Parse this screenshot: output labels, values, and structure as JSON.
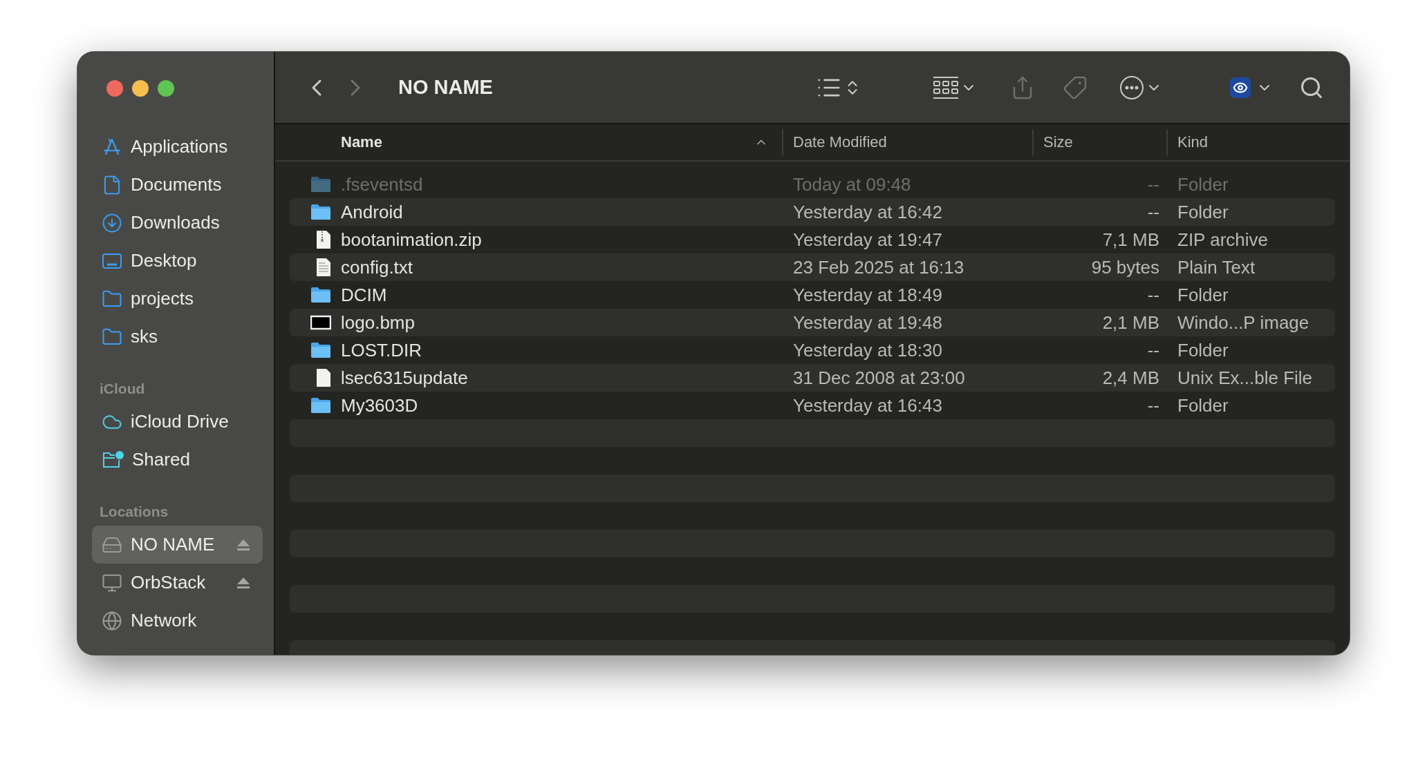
{
  "window": {
    "title": "NO NAME"
  },
  "toolbar": {
    "back_disabled": false,
    "forward_disabled": true,
    "share_disabled": true,
    "tags_disabled": true
  },
  "sidebar": {
    "sections": [
      {
        "items": [
          {
            "label": "Applications",
            "kind": "applications",
            "selected": false,
            "ejectable": false
          },
          {
            "label": "Documents",
            "kind": "documents",
            "selected": false,
            "ejectable": false
          },
          {
            "label": "Downloads",
            "kind": "downloads",
            "selected": false,
            "ejectable": false
          },
          {
            "label": "Desktop",
            "kind": "desktop",
            "selected": false,
            "ejectable": false
          },
          {
            "label": "projects",
            "kind": "folder",
            "selected": false,
            "ejectable": false
          },
          {
            "label": "sks",
            "kind": "folder",
            "selected": false,
            "ejectable": false
          }
        ]
      },
      {
        "title": "iCloud",
        "items": [
          {
            "label": "iCloud Drive",
            "kind": "cloud",
            "selected": false,
            "ejectable": false
          },
          {
            "label": "Shared",
            "kind": "shared",
            "selected": false,
            "ejectable": false
          }
        ]
      },
      {
        "title": "Locations",
        "items": [
          {
            "label": "NO NAME",
            "kind": "drive",
            "selected": true,
            "ejectable": true
          },
          {
            "label": "OrbStack",
            "kind": "computer",
            "selected": false,
            "ejectable": true
          },
          {
            "label": "Network",
            "kind": "network",
            "selected": false,
            "ejectable": false
          }
        ]
      }
    ]
  },
  "table": {
    "columns": [
      {
        "label": "Name",
        "sorted": true
      },
      {
        "label": "Date Modified",
        "sorted": false
      },
      {
        "label": "Size",
        "sorted": false
      },
      {
        "label": "Kind",
        "sorted": false
      }
    ],
    "rows": [
      {
        "name": ".fseventsd",
        "kind": "folder",
        "dimmed": true,
        "date_modified": "Today at 09:48",
        "size": "--",
        "file_kind": "Folder"
      },
      {
        "name": "Android",
        "kind": "folder",
        "dimmed": false,
        "date_modified": "Yesterday at 16:42",
        "size": "--",
        "file_kind": "Folder"
      },
      {
        "name": "bootanimation.zip",
        "kind": "archive",
        "dimmed": false,
        "date_modified": "Yesterday at 19:47",
        "size": "7,1 MB",
        "file_kind": "ZIP archive"
      },
      {
        "name": "config.txt",
        "kind": "text",
        "dimmed": false,
        "date_modified": "23 Feb 2025 at 16:13",
        "size": "95 bytes",
        "file_kind": "Plain Text"
      },
      {
        "name": "DCIM",
        "kind": "folder",
        "dimmed": false,
        "date_modified": "Yesterday at 18:49",
        "size": "--",
        "file_kind": "Folder"
      },
      {
        "name": "logo.bmp",
        "kind": "image",
        "dimmed": false,
        "date_modified": "Yesterday at 19:48",
        "size": "2,1 MB",
        "file_kind": "Windo...P image"
      },
      {
        "name": "LOST.DIR",
        "kind": "folder",
        "dimmed": false,
        "date_modified": "Yesterday at 18:30",
        "size": "--",
        "file_kind": "Folder"
      },
      {
        "name": "lsec6315update",
        "kind": "document",
        "dimmed": false,
        "date_modified": "31 Dec 2008 at 23:00",
        "size": "2,4 MB",
        "file_kind": "Unix Ex...ble File"
      },
      {
        "name": "My3603D",
        "kind": "folder",
        "dimmed": false,
        "date_modified": "Yesterday at 16:43",
        "size": "--",
        "file_kind": "Folder"
      }
    ]
  }
}
